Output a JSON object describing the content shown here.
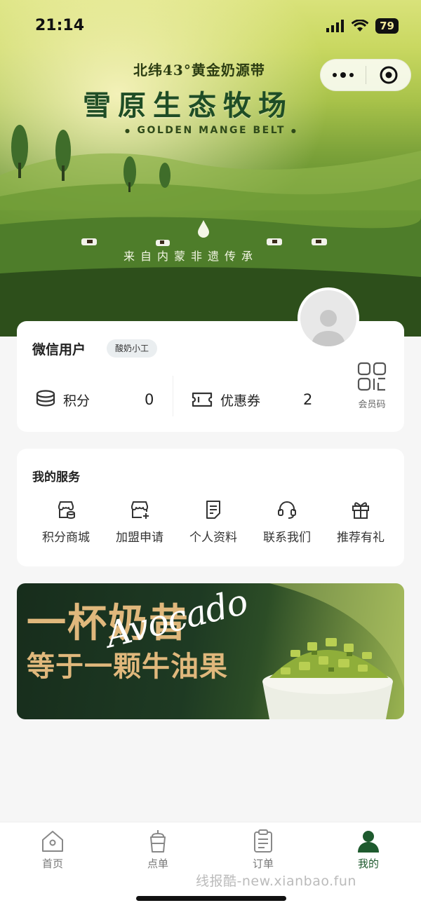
{
  "status_bar": {
    "time": "21:14",
    "battery": "79"
  },
  "hero": {
    "subtitle": "北纬43°黄金奶源带",
    "title": "雪原生态牧场",
    "english": "GOLDEN MANGE BELT",
    "slogan": "来自内蒙非遗传承"
  },
  "profile": {
    "name": "微信用户",
    "badge": "酸奶小工",
    "points_label": "积分",
    "points_value": "0",
    "coupons_label": "优惠券",
    "coupons_value": "2",
    "member_code_label": "会员码"
  },
  "services": {
    "title": "我的服务",
    "items": [
      {
        "label": "积分商城",
        "icon": "store-coin-icon"
      },
      {
        "label": "加盟申请",
        "icon": "shop-add-icon"
      },
      {
        "label": "个人资料",
        "icon": "profile-doc-icon"
      },
      {
        "label": "联系我们",
        "icon": "headset-icon"
      },
      {
        "label": "推荐有礼",
        "icon": "gift-icon"
      }
    ]
  },
  "banner": {
    "line1": "一杯奶昔",
    "line2": "等于一颗牛油果",
    "script": "Avocado"
  },
  "tabbar": {
    "items": [
      {
        "label": "首页",
        "icon": "home-icon"
      },
      {
        "label": "点单",
        "icon": "cup-icon"
      },
      {
        "label": "订单",
        "icon": "order-icon"
      },
      {
        "label": "我的",
        "icon": "user-icon"
      }
    ],
    "active": "我的"
  },
  "watermark": "线报酷-new.xianbao.fun",
  "colors": {
    "brand_green": "#1e5a2e",
    "accent_gold": "#e0b87c"
  }
}
